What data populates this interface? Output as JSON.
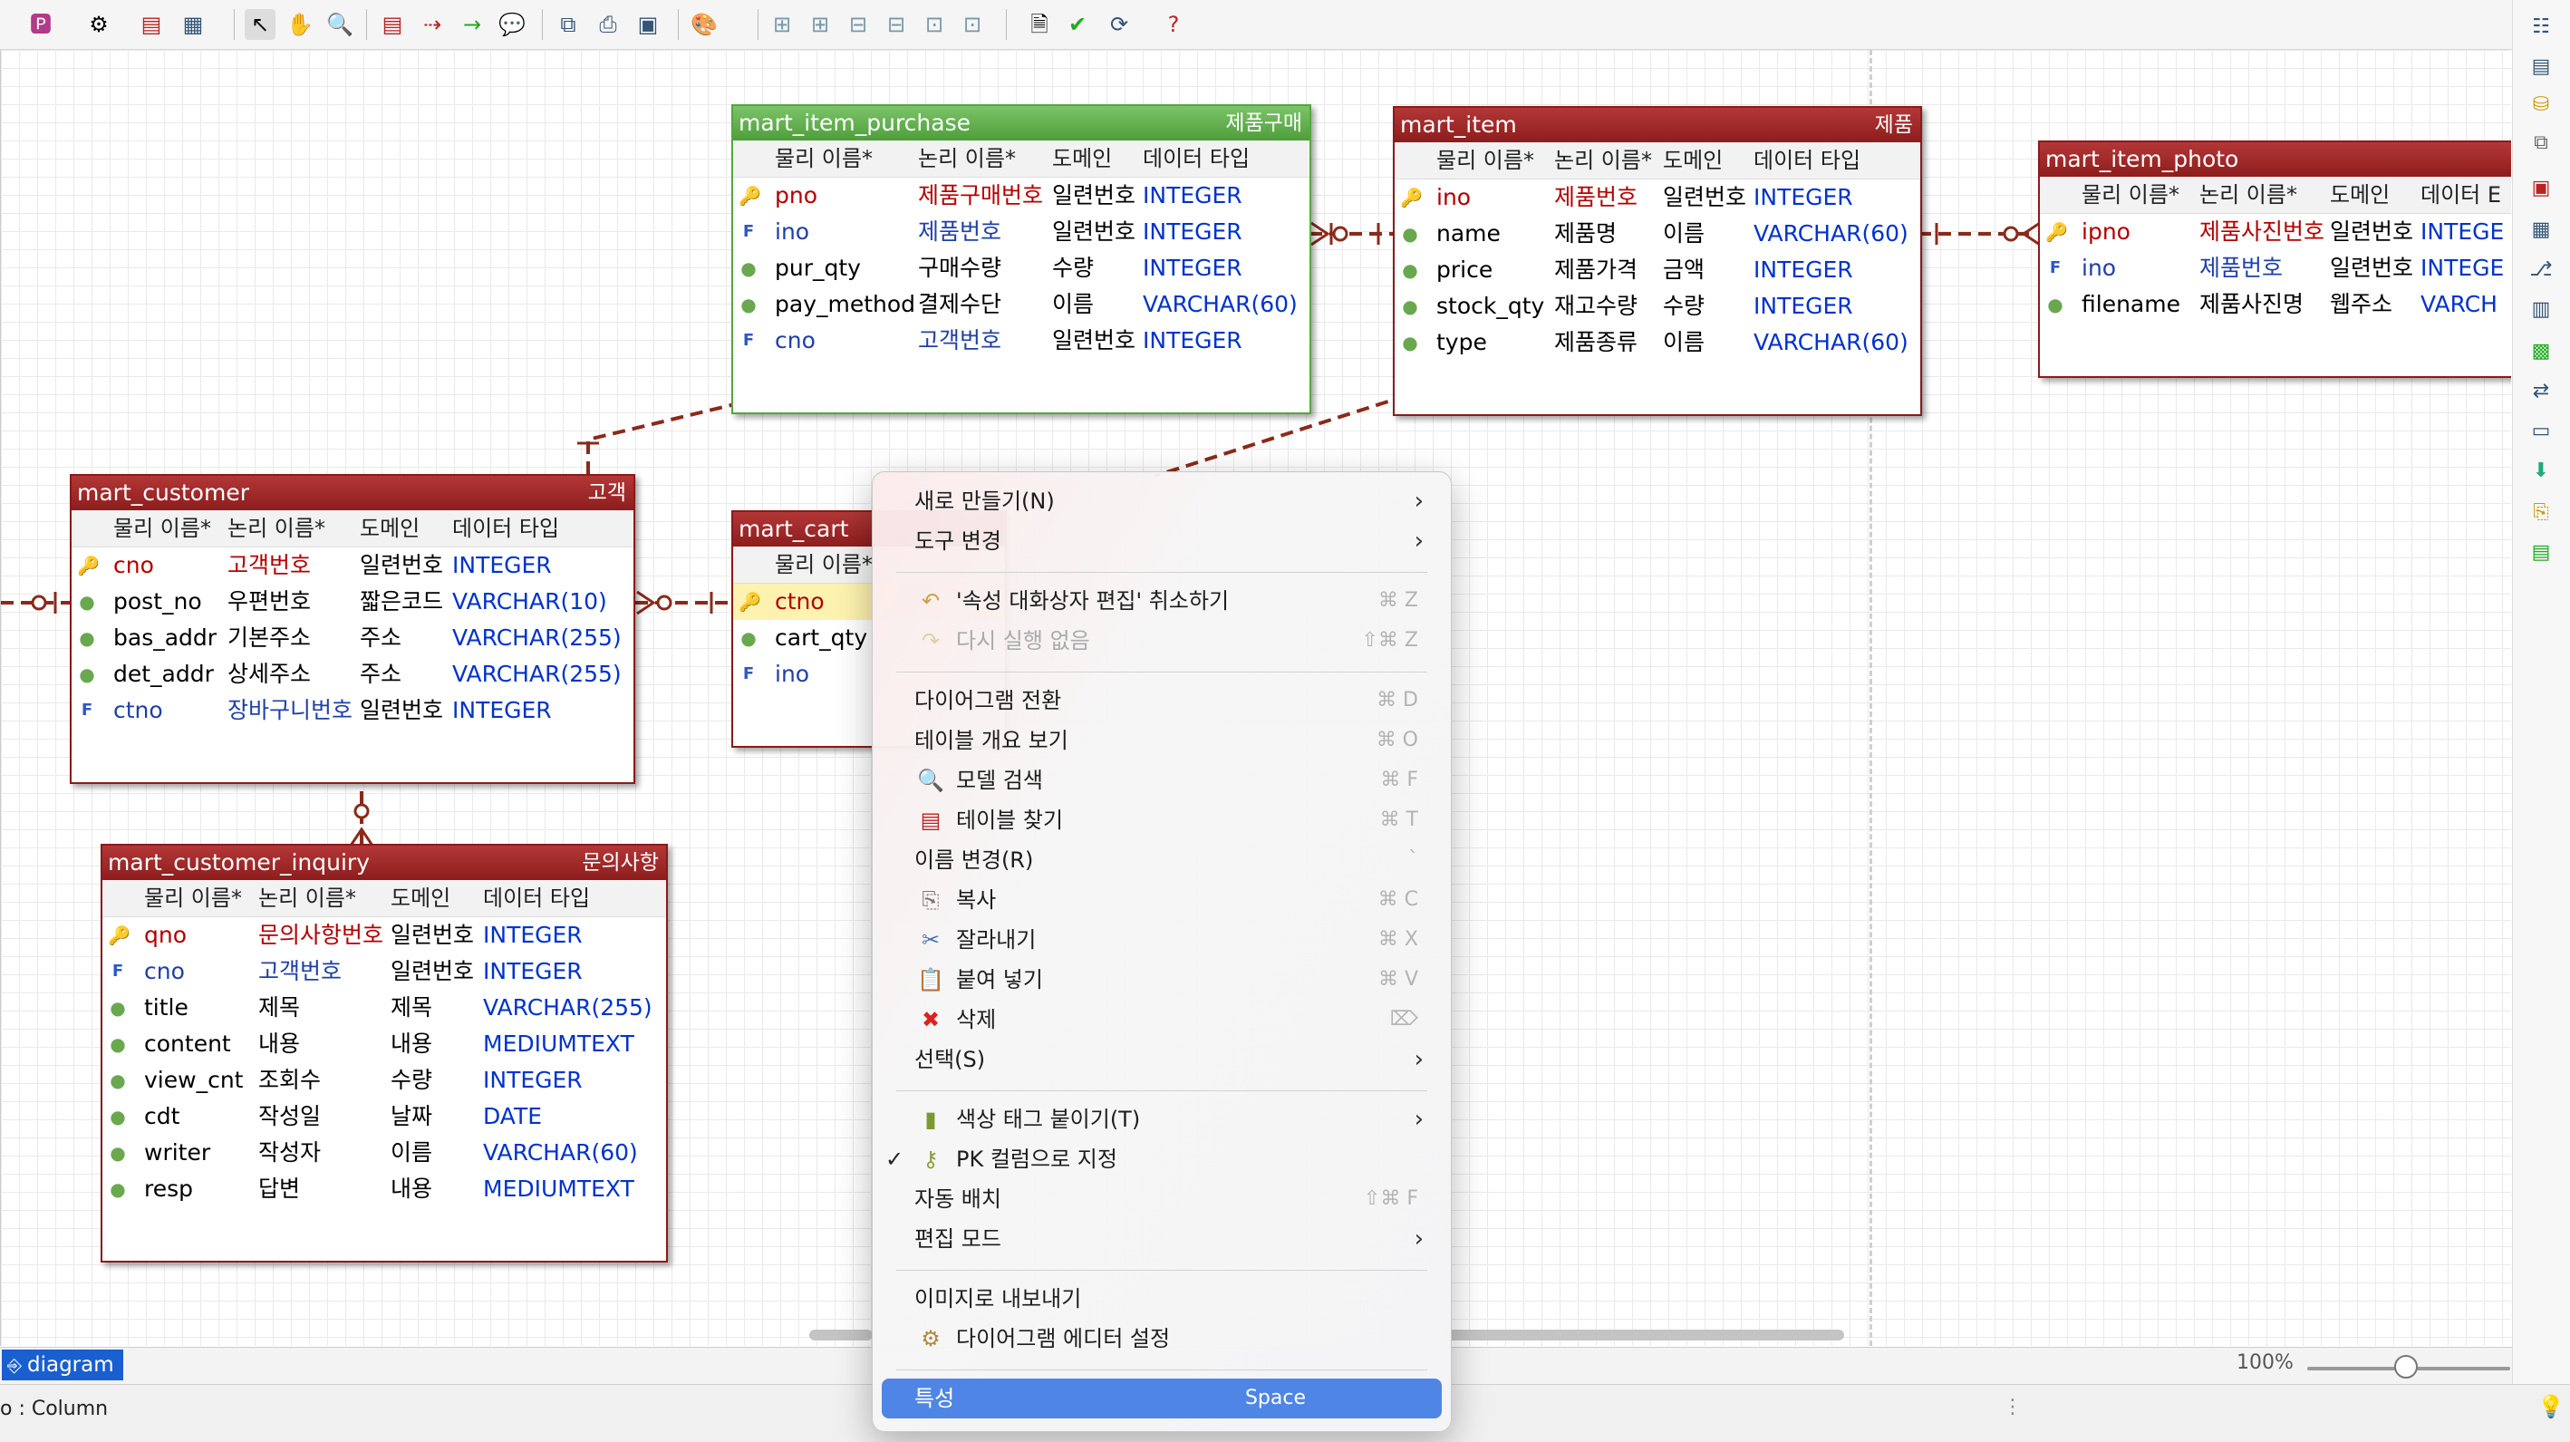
{
  "toolbar": {
    "buttons": [
      "palette-menu",
      "new-entity-menu",
      "table-view",
      "layout-menu",
      "select-tool",
      "hand-tool",
      "zoom-tool",
      "new-table",
      "identifying-relation",
      "non-identifying-relation",
      "note-tool",
      "copy-image",
      "print",
      "export-image",
      "color-menu",
      "align-left",
      "align-right",
      "align-top",
      "align-bottom",
      "align-center",
      "distribute",
      "check",
      "validate",
      "git-menu",
      "help"
    ]
  },
  "entities": {
    "purchase": {
      "name": "mart_item_purchase",
      "logical": "제품구매",
      "headers": [
        "물리 이름*",
        "논리 이름*",
        "도메인",
        "데이터 타입"
      ],
      "rows": [
        {
          "key": "pk",
          "physical": "pno",
          "logical": "제품구매번호",
          "domain": "일련번호",
          "type": "INTEGER"
        },
        {
          "key": "fk",
          "physical": "ino",
          "logical": "제품번호",
          "domain": "일련번호",
          "type": "INTEGER"
        },
        {
          "key": "attr",
          "physical": "pur_qty",
          "logical": "구매수량",
          "domain": "수량",
          "type": "INTEGER"
        },
        {
          "key": "attr",
          "physical": "pay_method",
          "logical": "결제수단",
          "domain": "이름",
          "type": "VARCHAR(60)"
        },
        {
          "key": "fk",
          "physical": "cno",
          "logical": "고객번호",
          "domain": "일련번호",
          "type": "INTEGER"
        }
      ]
    },
    "item": {
      "name": "mart_item",
      "logical": "제품",
      "headers": [
        "물리 이름*",
        "논리 이름*",
        "도메인",
        "데이터 타입"
      ],
      "rows": [
        {
          "key": "pk",
          "physical": "ino",
          "logical": "제품번호",
          "domain": "일련번호",
          "type": "INTEGER"
        },
        {
          "key": "attr",
          "physical": "name",
          "logical": "제품명",
          "domain": "이름",
          "type": "VARCHAR(60)"
        },
        {
          "key": "attr",
          "physical": "price",
          "logical": "제품가격",
          "domain": "금액",
          "type": "INTEGER"
        },
        {
          "key": "attr",
          "physical": "stock_qty",
          "logical": "재고수량",
          "domain": "수량",
          "type": "INTEGER"
        },
        {
          "key": "attr",
          "physical": "type",
          "logical": "제품종류",
          "domain": "이름",
          "type": "VARCHAR(60)"
        }
      ]
    },
    "photo": {
      "name": "mart_item_photo",
      "headers": [
        "물리 이름*",
        "논리 이름*",
        "도메인",
        "데이터 E"
      ],
      "rows": [
        {
          "key": "pk",
          "physical": "ipno",
          "logical": "제품사진번호",
          "domain": "일련번호",
          "type": "INTEGE"
        },
        {
          "key": "fk",
          "physical": "ino",
          "logical": "제품번호",
          "domain": "일련번호",
          "type": "INTEGE"
        },
        {
          "key": "attr",
          "physical": "filename",
          "logical": "제품사진명",
          "domain": "웹주소",
          "type": "VARCH"
        }
      ]
    },
    "customer": {
      "name": "mart_customer",
      "logical": "고객",
      "headers": [
        "물리 이름*",
        "논리 이름*",
        "도메인",
        "데이터 타입"
      ],
      "rows": [
        {
          "key": "pk",
          "physical": "cno",
          "logical": "고객번호",
          "domain": "일련번호",
          "type": "INTEGER"
        },
        {
          "key": "attr",
          "physical": "post_no",
          "logical": "우편번호",
          "domain": "짧은코드",
          "type": "VARCHAR(10)"
        },
        {
          "key": "attr",
          "physical": "bas_addr",
          "logical": "기본주소",
          "domain": "주소",
          "type": "VARCHAR(255)"
        },
        {
          "key": "attr",
          "physical": "det_addr",
          "logical": "상세주소",
          "domain": "주소",
          "type": "VARCHAR(255)"
        },
        {
          "key": "fk",
          "physical": "ctno",
          "logical": "장바구니번호",
          "domain": "일련번호",
          "type": "INTEGER"
        }
      ]
    },
    "cart": {
      "name": "mart_cart",
      "headers": [
        "물리 이름*"
      ],
      "rows": [
        {
          "key": "pk",
          "physical": "ctno"
        },
        {
          "key": "attr",
          "physical": "cart_qty"
        },
        {
          "key": "fk",
          "physical": "ino"
        }
      ]
    },
    "inquiry": {
      "name": "mart_customer_inquiry",
      "logical": "문의사항",
      "headers": [
        "물리 이름*",
        "논리 이름*",
        "도메인",
        "데이터 타입"
      ],
      "rows": [
        {
          "key": "pk",
          "physical": "qno",
          "logical": "문의사항번호",
          "domain": "일련번호",
          "type": "INTEGER"
        },
        {
          "key": "fk",
          "physical": "cno",
          "logical": "고객번호",
          "domain": "일련번호",
          "type": "INTEGER"
        },
        {
          "key": "attr",
          "physical": "title",
          "logical": "제목",
          "domain": "제목",
          "type": "VARCHAR(255)"
        },
        {
          "key": "attr",
          "physical": "content",
          "logical": "내용",
          "domain": "내용",
          "type": "MEDIUMTEXT"
        },
        {
          "key": "attr",
          "physical": "view_cnt",
          "logical": "조회수",
          "domain": "수량",
          "type": "INTEGER"
        },
        {
          "key": "attr",
          "physical": "cdt",
          "logical": "작성일",
          "domain": "날짜",
          "type": "DATE"
        },
        {
          "key": "attr",
          "physical": "writer",
          "logical": "작성자",
          "domain": "이름",
          "type": "VARCHAR(60)"
        },
        {
          "key": "attr",
          "physical": "resp",
          "logical": "답변",
          "domain": "내용",
          "type": "MEDIUMTEXT"
        }
      ]
    }
  },
  "context_menu": {
    "new": {
      "label": "새로 만들기(N)"
    },
    "change_tool": {
      "label": "도구 변경"
    },
    "undo": {
      "label": "'속성 대화상자 편집' 취소하기",
      "shortcut": "⌘ Z",
      "icon": "undo-icon"
    },
    "redo": {
      "label": "다시 실행 없음",
      "shortcut": "⇧⌘ Z",
      "icon": "redo-icon"
    },
    "switch_diagram": {
      "label": "다이어그램 전환",
      "shortcut": "⌘ D"
    },
    "table_overview": {
      "label": "테이블 개요 보기",
      "shortcut": "⌘ O"
    },
    "model_search": {
      "label": "모델 검색",
      "shortcut": "⌘ F",
      "icon": "search-icon"
    },
    "find_table": {
      "label": "테이블 찾기",
      "shortcut": "⌘ T",
      "icon": "table-icon"
    },
    "rename": {
      "label": "이름 변경(R)",
      "shortcut": "`"
    },
    "copy": {
      "label": "복사",
      "shortcut": "⌘ C",
      "icon": "copy-icon"
    },
    "cut": {
      "label": "잘라내기",
      "shortcut": "⌘ X",
      "icon": "scissors-icon"
    },
    "paste": {
      "label": "붙여 넣기",
      "shortcut": "⌘ V",
      "icon": "paste-icon"
    },
    "delete": {
      "label": "삭제",
      "shortcut": "⌦",
      "icon": "delete-icon"
    },
    "select": {
      "label": "선택(S)"
    },
    "color_tag": {
      "label": "색상 태그 붙이기(T)",
      "icon": "tag-icon"
    },
    "set_pk": {
      "label": "PK 컬럼으로 지정",
      "checked": true,
      "icon": "key-icon"
    },
    "auto_layout": {
      "label": "자동 배치",
      "shortcut": "⇧⌘ F"
    },
    "edit_mode": {
      "label": "편집 모드"
    },
    "export_image": {
      "label": "이미지로 내보내기"
    },
    "editor_settings": {
      "label": "다이어그램 에디터 설정",
      "icon": "gear-icon"
    },
    "properties": {
      "label": "특성",
      "shortcut": "Space"
    }
  },
  "bottom": {
    "tab_label": "diagram",
    "zoom": "100%",
    "status": "o : Column"
  },
  "colors": {
    "entity_header": "#8d1d1d",
    "entity_header_selected": "#4f9d3b",
    "relation_line": "#8b2a1a",
    "menu_highlight": "#4f86e6",
    "tab_active": "#1a5fd0"
  }
}
